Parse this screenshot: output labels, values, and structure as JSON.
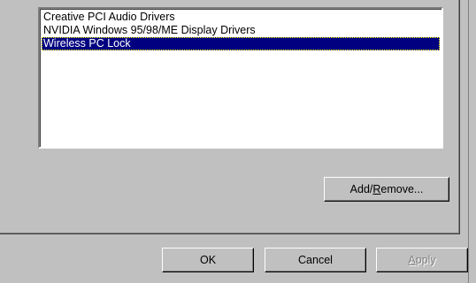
{
  "list": {
    "items": [
      {
        "label": "Creative PCI Audio Drivers"
      },
      {
        "label": "NVIDIA Windows 95/98/ME Display Drivers"
      },
      {
        "label": "Wireless PC Lock",
        "selected": true
      }
    ]
  },
  "buttons": {
    "add_remove": {
      "before": "Add/",
      "accel": "R",
      "after": "emove..."
    },
    "ok": "OK",
    "cancel": "Cancel",
    "apply": {
      "accel": "A",
      "after": "pply",
      "disabled": true
    }
  },
  "colors": {
    "face": "#c0c0c0",
    "selection": "#000080",
    "list_bg": "#ffffff",
    "disabled_text": "#808080"
  }
}
